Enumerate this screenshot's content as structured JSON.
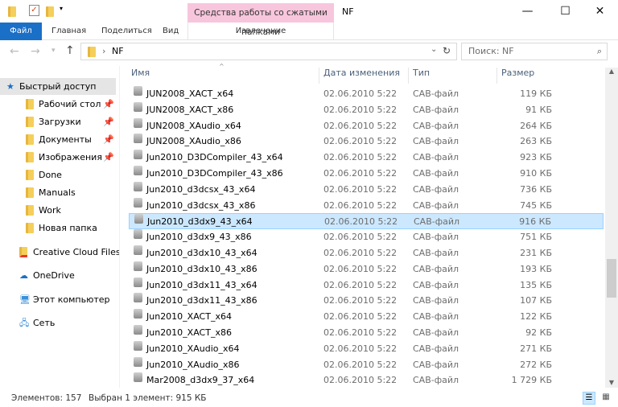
{
  "window": {
    "title": "NF",
    "contextual_tab_group": "Средства работы со сжатыми папками"
  },
  "ribbon": {
    "tabs": [
      "Файл",
      "Главная",
      "Поделиться",
      "Вид"
    ],
    "contextual_tab": "Извлечение"
  },
  "address": {
    "path": "NF",
    "search_placeholder": "Поиск: NF"
  },
  "sidebar": {
    "quick_access": "Быстрый доступ",
    "pinned": [
      "Рабочий стол",
      "Загрузки",
      "Документы",
      "Изображения"
    ],
    "folders": [
      "Done",
      "Manuals",
      "Work",
      "Новая папка"
    ],
    "other": [
      "Creative Cloud Files",
      "OneDrive",
      "Этот компьютер",
      "Сеть"
    ]
  },
  "columns": {
    "name": "Имя",
    "date": "Дата изменения",
    "type": "Тип",
    "size": "Размер"
  },
  "files": [
    {
      "name": "JUN2008_XACT_x64",
      "date": "02.06.2010 5:22",
      "type": "CAB-файл",
      "size": "119 КБ"
    },
    {
      "name": "JUN2008_XACT_x86",
      "date": "02.06.2010 5:22",
      "type": "CAB-файл",
      "size": "91 КБ"
    },
    {
      "name": "JUN2008_XAudio_x64",
      "date": "02.06.2010 5:22",
      "type": "CAB-файл",
      "size": "264 КБ"
    },
    {
      "name": "JUN2008_XAudio_x86",
      "date": "02.06.2010 5:22",
      "type": "CAB-файл",
      "size": "263 КБ"
    },
    {
      "name": "Jun2010_D3DCompiler_43_x64",
      "date": "02.06.2010 5:22",
      "type": "CAB-файл",
      "size": "923 КБ"
    },
    {
      "name": "Jun2010_D3DCompiler_43_x86",
      "date": "02.06.2010 5:22",
      "type": "CAB-файл",
      "size": "910 КБ"
    },
    {
      "name": "Jun2010_d3dcsx_43_x64",
      "date": "02.06.2010 5:22",
      "type": "CAB-файл",
      "size": "736 КБ"
    },
    {
      "name": "Jun2010_d3dcsx_43_x86",
      "date": "02.06.2010 5:22",
      "type": "CAB-файл",
      "size": "745 КБ"
    },
    {
      "name": "Jun2010_d3dx9_43_x64",
      "date": "02.06.2010 5:22",
      "type": "CAB-файл",
      "size": "916 КБ",
      "selected": true
    },
    {
      "name": "Jun2010_d3dx9_43_x86",
      "date": "02.06.2010 5:22",
      "type": "CAB-файл",
      "size": "751 КБ"
    },
    {
      "name": "Jun2010_d3dx10_43_x64",
      "date": "02.06.2010 5:22",
      "type": "CAB-файл",
      "size": "231 КБ"
    },
    {
      "name": "Jun2010_d3dx10_43_x86",
      "date": "02.06.2010 5:22",
      "type": "CAB-файл",
      "size": "193 КБ"
    },
    {
      "name": "Jun2010_d3dx11_43_x64",
      "date": "02.06.2010 5:22",
      "type": "CAB-файл",
      "size": "135 КБ"
    },
    {
      "name": "Jun2010_d3dx11_43_x86",
      "date": "02.06.2010 5:22",
      "type": "CAB-файл",
      "size": "107 КБ"
    },
    {
      "name": "Jun2010_XACT_x64",
      "date": "02.06.2010 5:22",
      "type": "CAB-файл",
      "size": "122 КБ"
    },
    {
      "name": "Jun2010_XACT_x86",
      "date": "02.06.2010 5:22",
      "type": "CAB-файл",
      "size": "92 КБ"
    },
    {
      "name": "Jun2010_XAudio_x64",
      "date": "02.06.2010 5:22",
      "type": "CAB-файл",
      "size": "271 КБ"
    },
    {
      "name": "Jun2010_XAudio_x86",
      "date": "02.06.2010 5:22",
      "type": "CAB-файл",
      "size": "272 КБ"
    },
    {
      "name": "Mar2008_d3dx9_37_x64",
      "date": "02.06.2010 5:22",
      "type": "CAB-файл",
      "size": "1 729 КБ"
    }
  ],
  "status": {
    "count": "Элементов: 157",
    "selection": "Выбран 1 элемент: 915 КБ"
  },
  "colors": {
    "accent": "#1a6fc7",
    "contextual": "#f7c6dc",
    "selection": "#cce8ff"
  }
}
